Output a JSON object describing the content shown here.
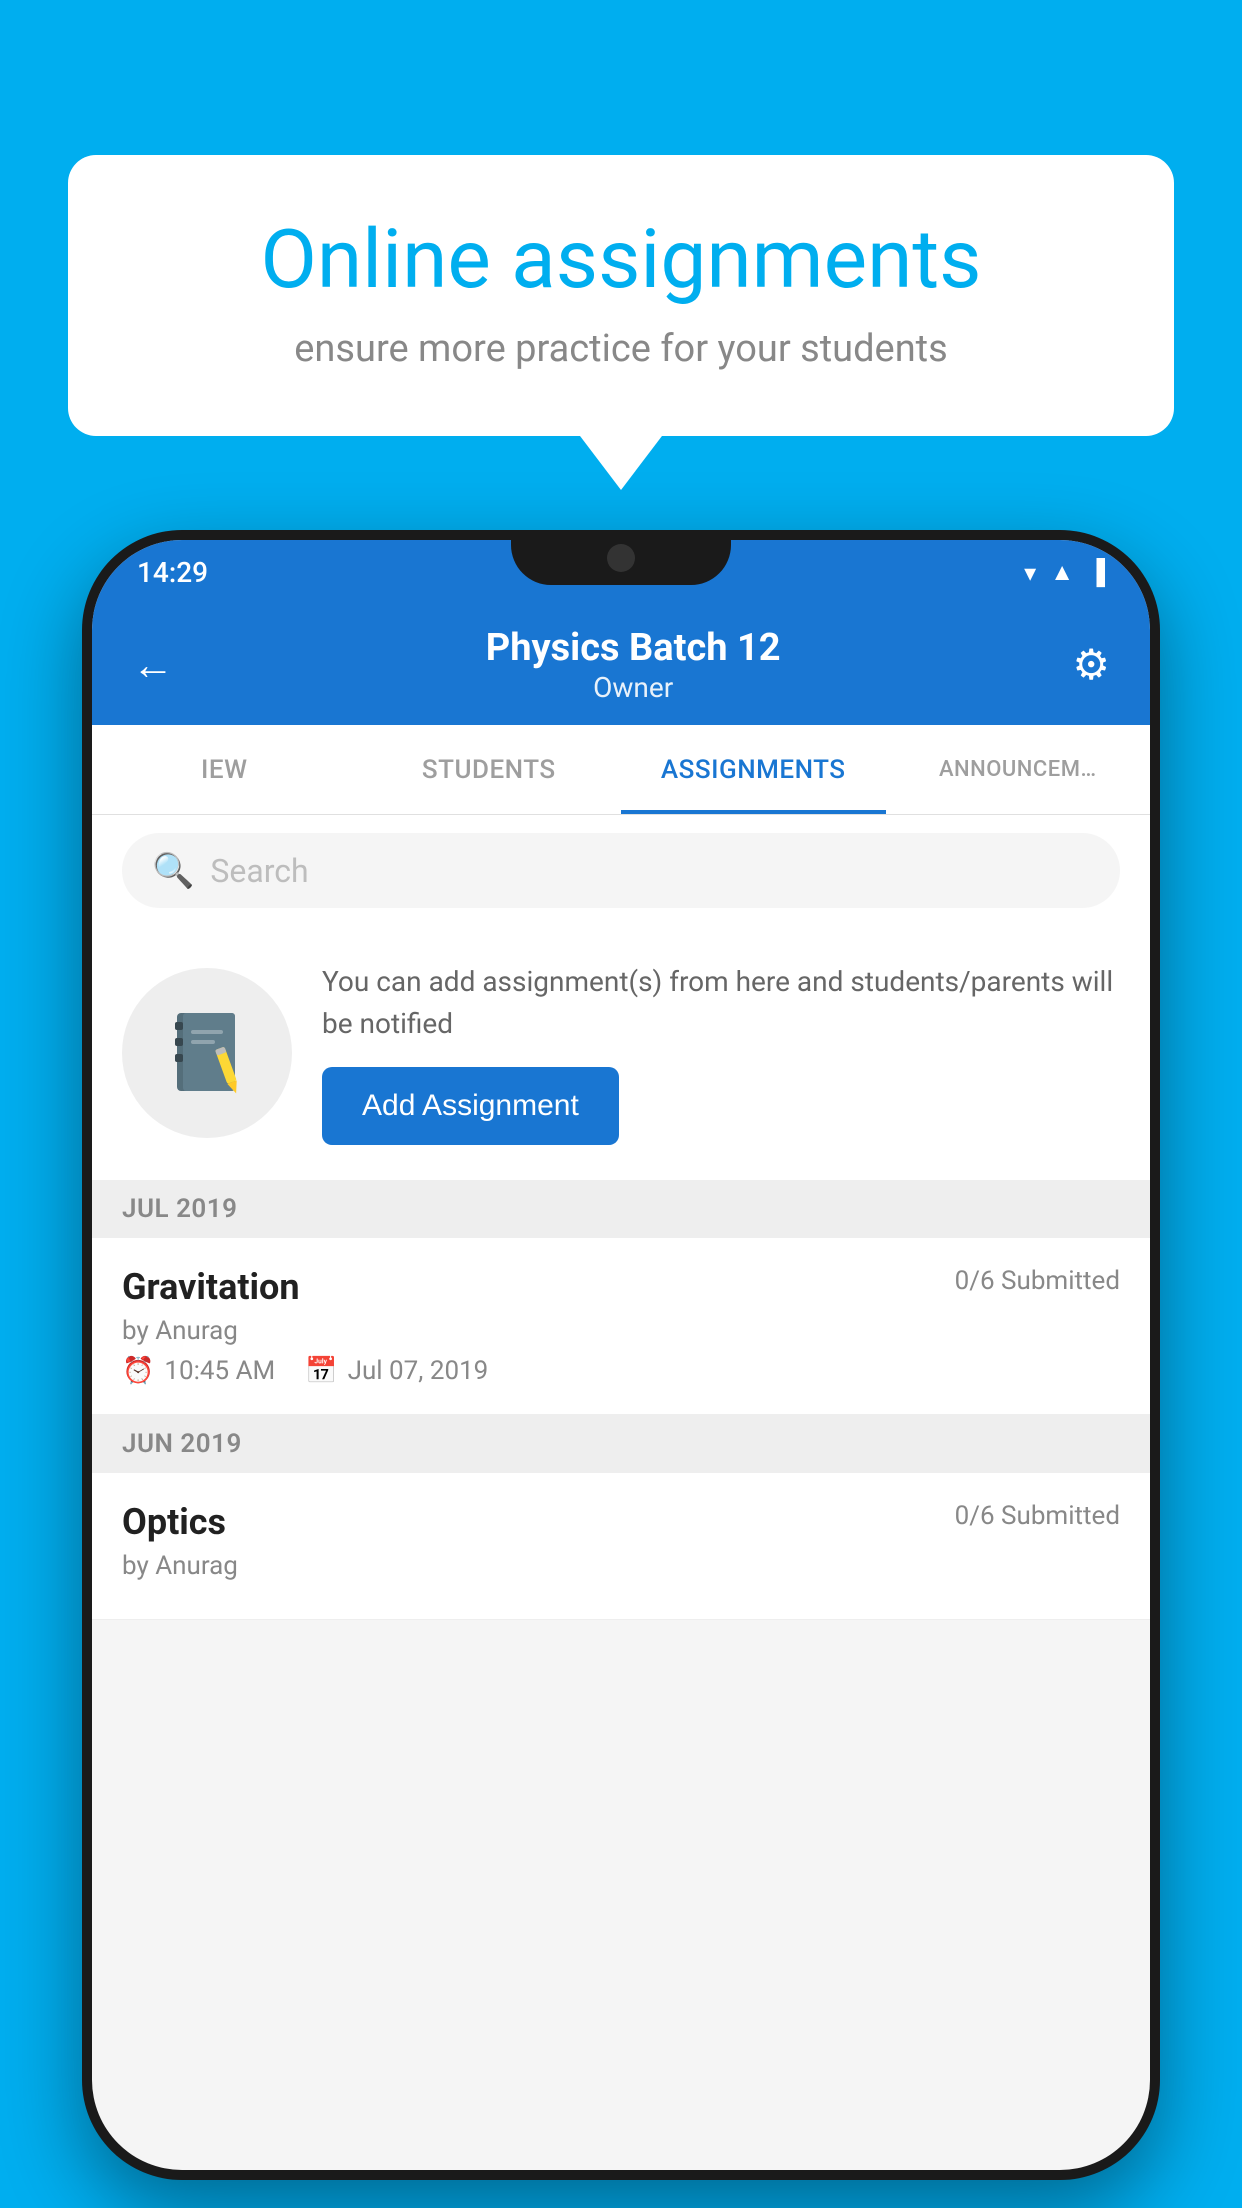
{
  "background_color": "#00AEEF",
  "speech_bubble": {
    "title": "Online assignments",
    "subtitle": "ensure more practice for your students"
  },
  "phone": {
    "status_bar": {
      "time": "14:29",
      "wifi": "▾",
      "signal": "▲",
      "battery": "▐"
    },
    "app_bar": {
      "title": "Physics Batch 12",
      "subtitle": "Owner",
      "back_label": "←",
      "settings_label": "⚙"
    },
    "tabs": [
      {
        "label": "IEW",
        "active": false
      },
      {
        "label": "STUDENTS",
        "active": false
      },
      {
        "label": "ASSIGNMENTS",
        "active": true
      },
      {
        "label": "ANNOUNCEM…",
        "active": false
      }
    ],
    "search": {
      "placeholder": "Search"
    },
    "promo": {
      "description": "You can add assignment(s) from here and students/parents will be notified",
      "button_label": "Add Assignment"
    },
    "sections": [
      {
        "month_label": "JUL 2019",
        "assignments": [
          {
            "title": "Gravitation",
            "submitted": "0/6 Submitted",
            "author": "by Anurag",
            "time": "10:45 AM",
            "date": "Jul 07, 2019"
          }
        ]
      },
      {
        "month_label": "JUN 2019",
        "assignments": [
          {
            "title": "Optics",
            "submitted": "0/6 Submitted",
            "author": "by Anurag",
            "time": "",
            "date": ""
          }
        ]
      }
    ]
  }
}
